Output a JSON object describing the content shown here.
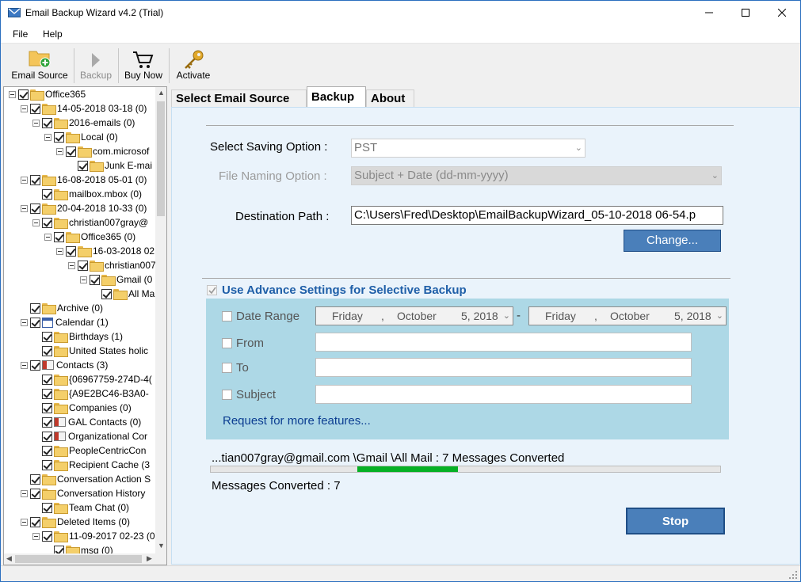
{
  "window": {
    "title": "Email Backup Wizard v4.2 (Trial)"
  },
  "menu": {
    "file": "File",
    "help": "Help"
  },
  "toolbar": {
    "email_source": "Email Source",
    "backup": "Backup",
    "buy_now": "Buy Now",
    "activate": "Activate"
  },
  "tree": {
    "items": [
      "Office365",
      "14-05-2018 03-18  (0)",
      "2016-emails  (0)",
      "Local  (0)",
      "com.microsof",
      "Junk E-mai",
      "16-08-2018 05-01  (0)",
      "mailbox.mbox (0)",
      "20-04-2018 10-33  (0)",
      "christian007gray@",
      "Office365  (0)",
      "16-03-2018 02",
      "christian007",
      "Gmail  (0",
      "All Ma",
      "Archive (0)",
      "Calendar (1)",
      "Birthdays (1)",
      "United States holic",
      "Contacts (3)",
      "{06967759-274D-4(",
      "{A9E2BC46-B3A0-",
      "Companies (0)",
      "GAL Contacts (0)",
      "Organizational Cor",
      "PeopleCentricCon",
      "Recipient Cache (3",
      "Conversation Action S",
      "Conversation History",
      "Team Chat (0)",
      "Deleted Items (0)",
      "11-09-2017 02-23 (0",
      "msg (0)"
    ]
  },
  "tabs": [
    "Select Email Source",
    "Backup",
    "About"
  ],
  "backup": {
    "saving_label": "Select Saving Option :",
    "saving_value": "PST",
    "naming_label": "File Naming Option :",
    "naming_value": "Subject + Date (dd-mm-yyyy)",
    "dest_label": "Destination Path :",
    "dest_value": "C:\\Users\\Fred\\Desktop\\EmailBackupWizard_05-10-2018 06-54.p",
    "change_button": "Change...",
    "advance_label": "Use Advance Settings for Selective Backup",
    "date_range": "Date Range",
    "from": "From",
    "to": "To",
    "subject": "Subject",
    "date_start": {
      "day": "Friday",
      "sep": ",",
      "month": "October",
      "date": "5, 2018"
    },
    "date_end": {
      "day": "Friday",
      "sep": ",",
      "month": "October",
      "date": "5, 2018"
    },
    "dash": "-",
    "request_link": "Request for more features...",
    "status_line": "...tian007gray@gmail.com  \\Gmail  \\All Mail : 7 Messages Converted",
    "converted_line": "Messages Converted : 7",
    "progress_start": 0.287,
    "progress_end": 0.484,
    "stop_button": "Stop"
  },
  "colors": {
    "accent": "#1f5fa8",
    "button_blue": "#4a7fba",
    "advance_bg": "#add8e6",
    "progress": "#06b025",
    "link": "#0b3d91"
  }
}
